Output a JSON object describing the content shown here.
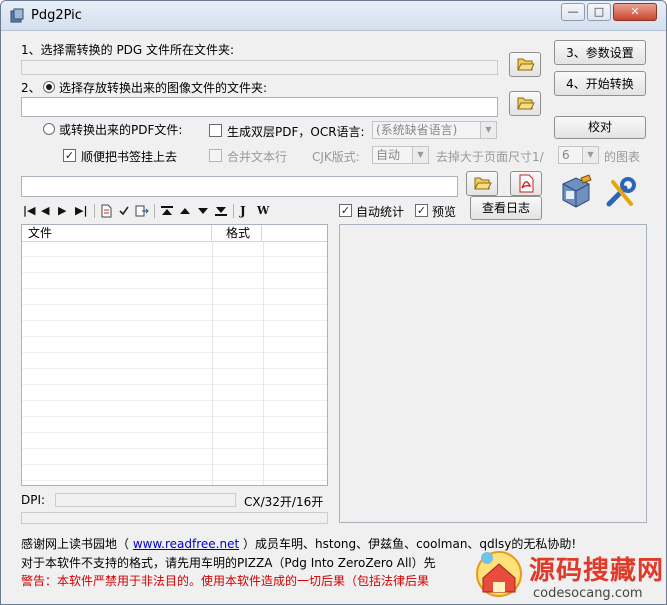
{
  "window": {
    "title": "Pdg2Pic",
    "minimize": "—",
    "maximize": "□",
    "close": "✕"
  },
  "step1": {
    "label": "1、选择需转换的 PDG 文件所在文件夹:",
    "path_value": ""
  },
  "step2": {
    "label": "2、",
    "radio_label": "选择存放转换出来的图像文件的文件夹:",
    "path_value": ""
  },
  "pdf": {
    "radio_label": "或转换出来的PDF文件:",
    "dual_layer_label": "生成双层PDF，OCR语言:",
    "ocr_language": "(系统缺省语言)",
    "bookmark_label": "顺便把书签挂上去",
    "bookmark_checked": true,
    "merge_text_label": "合并文本行",
    "cjk_label": "CJK版式:",
    "cjk_value": "自动",
    "remove_label_pre": "去掉大于页面尺寸1/",
    "remove_value": "6",
    "remove_label_post": "的图表",
    "pdf_path_value": ""
  },
  "buttons": {
    "settings": "3、参数设置",
    "start": "4、开始转换",
    "verify": "校对",
    "view_log": "查看日志"
  },
  "options": {
    "auto_stats": "自动统计",
    "auto_stats_checked": true,
    "preview": "预览",
    "preview_checked": true
  },
  "toolbar": {
    "first": "|◀",
    "prev": "◀",
    "next": "▶",
    "last": "▶|",
    "bold_j": "J",
    "bold_w": "W"
  },
  "filelist": {
    "col_file": "文件",
    "col_format": "格式"
  },
  "dpi": {
    "label": "DPI:",
    "size": "CX/32开/16开"
  },
  "footer": {
    "thanks_pre": "感谢网上读书园地（",
    "thanks_link": "www.readfree.net",
    "thanks_post": "）成员车明、hstong、伊兹鱼、coolman、qdlsy的无私协助!",
    "line2": "对于本软件不支持的格式，请先用车明的PIZZA（Pdg Into ZeroZero All）先",
    "warning": "警告：本软件严禁用于非法目的。使用本软件造成的一切后果（包括法律后果"
  },
  "watermark": {
    "cn": "源码搜藏网",
    "url": "codesocang.com"
  }
}
